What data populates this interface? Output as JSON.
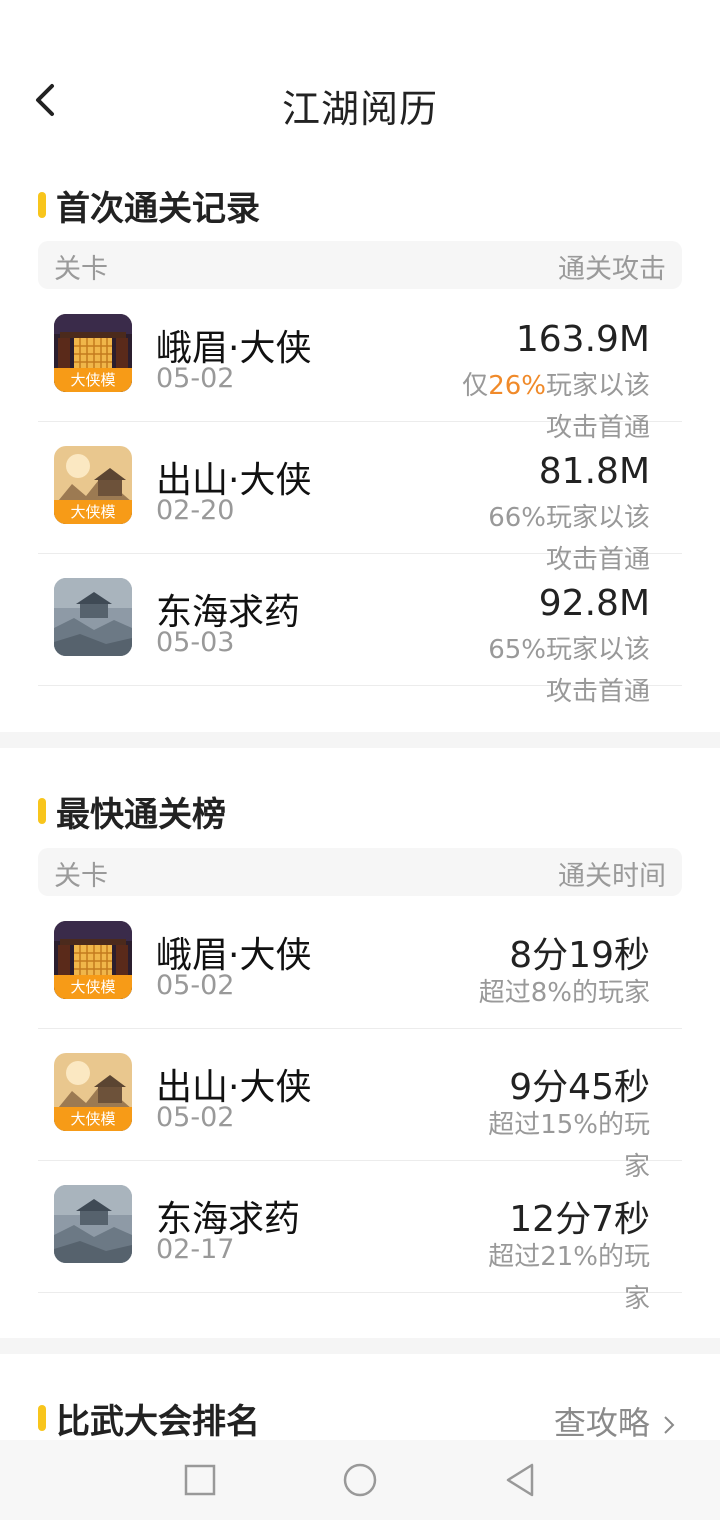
{
  "header": {
    "title": "江湖阅历"
  },
  "first_clear": {
    "title": "首次通关记录",
    "col_left": "关卡",
    "col_right": "通关攻击",
    "rows": [
      {
        "name": "峨眉·大侠",
        "date": "05-02",
        "value": "163.9M",
        "sub_prefix": "仅",
        "sub_percent": "26%",
        "sub_suffix": "玩家以该攻击首通",
        "thumb_tag": "大侠模",
        "thumb_icon": "palace-gate-scene-icon"
      },
      {
        "name": "出山·大侠",
        "date": "02-20",
        "value": "81.8M",
        "sub": "66%玩家以该攻击首通",
        "thumb_tag": "大侠模",
        "thumb_icon": "mountain-temple-scene-icon"
      },
      {
        "name": "东海求药",
        "date": "05-03",
        "value": "92.8M",
        "sub": "65%玩家以该攻击首通",
        "thumb_icon": "misty-pavilion-scene-icon"
      }
    ]
  },
  "fastest": {
    "title": "最快通关榜",
    "col_left": "关卡",
    "col_right": "通关时间",
    "rows": [
      {
        "name": "峨眉·大侠",
        "date": "05-02",
        "value": "8分19秒",
        "sub": "超过8%的玩家",
        "thumb_tag": "大侠模"
      },
      {
        "name": "出山·大侠",
        "date": "05-02",
        "value": "9分45秒",
        "sub": "超过15%的玩家",
        "thumb_tag": "大侠模"
      },
      {
        "name": "东海求药",
        "date": "02-17",
        "value": "12分7秒",
        "sub": "超过21%的玩家"
      }
    ]
  },
  "arena": {
    "title": "比武大会排名",
    "link": "查攻略"
  },
  "colors": {
    "accent_bar": "#f8c51c",
    "highlight": "#f08a2a",
    "tag": "#f79b17"
  },
  "nav": {
    "icons": [
      "square-recent-apps-icon",
      "circle-home-icon",
      "triangle-back-icon"
    ]
  }
}
